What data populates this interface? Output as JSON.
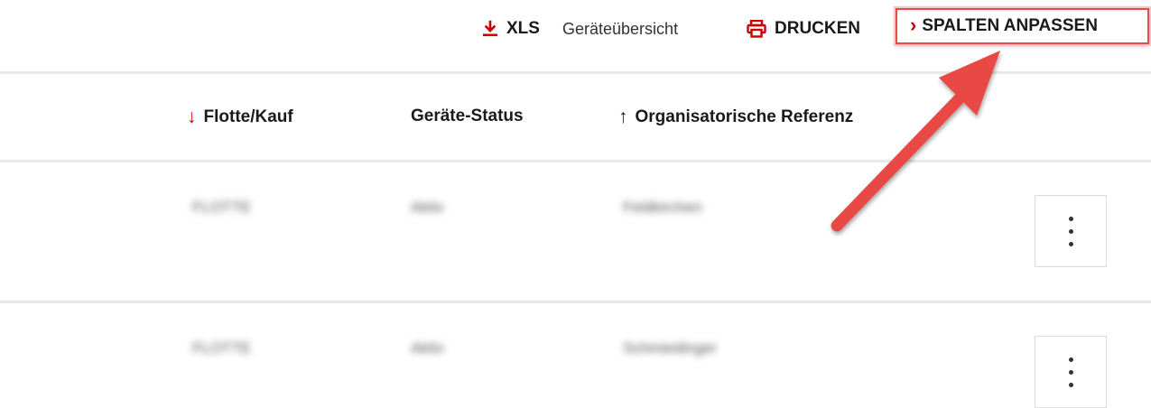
{
  "toolbar": {
    "xls_label": "XLS",
    "xls_description": "Geräteübersicht",
    "print_label": "DRUCKEN",
    "columns_chevron": "›",
    "columns_label": "SPALTEN ANPASSEN"
  },
  "table": {
    "headers": [
      {
        "label": "Flotte/Kauf",
        "sort": "desc",
        "sort_glyph": "↓"
      },
      {
        "label": "Geräte-Status",
        "sort": "none"
      },
      {
        "label": "Organisatorische Referenz",
        "sort": "asc",
        "sort_glyph": "↑"
      }
    ],
    "rows": [
      {
        "fleet": "FLOTTE",
        "status": "Aktiv",
        "org": "Feldkirchen"
      },
      {
        "fleet": "FLOTTE",
        "status": "Aktiv",
        "org": "Schmiedinger"
      }
    ]
  },
  "colors": {
    "accent": "#cc0000",
    "divider": "#ebe7e2",
    "annotation": "#e84a45"
  },
  "icons": {
    "xls": "download-icon",
    "print": "printer-icon",
    "menu": "more-vertical-icon",
    "annotation": "arrow-annotation"
  }
}
